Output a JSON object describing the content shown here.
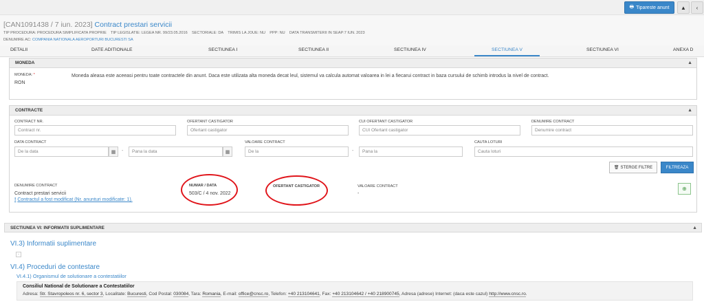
{
  "toolbar": {
    "print_label": "Tipareste anunt",
    "collapse_symbol": "▲",
    "back_symbol": "‹"
  },
  "header": {
    "code": "[CAN1091438 / 7 iun. 2023]",
    "title": "Contract prestari servicii",
    "meta_row1": [
      {
        "label": "TIP PROCEDURA:",
        "value": "PROCEDURA SIMPLIFICATA PROPRIE"
      },
      {
        "label": "TIP LEGISLATIE:",
        "value": "LEGEA NR. 99/23.05.2016"
      },
      {
        "label": "SECTORIALE:",
        "value": "DA"
      },
      {
        "label": "TRIMIS LA JOUE:",
        "value": "NU"
      },
      {
        "label": "PPP:",
        "value": "NU"
      },
      {
        "label": "DATA TRANSMITERII IN SEAP:",
        "value": "7 IUN. 2023"
      }
    ],
    "authority_label": "DENUMIRE AC:",
    "authority_value": "COMPANIA NATIONALA AEROPORTURI BUCURESTI SA"
  },
  "tabs": [
    "DETALII",
    "DATE ADITIONALE",
    "SECTIUNEA I",
    "SECTIUNEA II",
    "SECTIUNEA IV",
    "SECTIUNEA V",
    "SECTIUNEA VI",
    "ANEXA D"
  ],
  "active_tab": "SECTIUNEA V",
  "moneda": {
    "heading": "MONEDA",
    "label": "MONEDA:",
    "required_mark": "*",
    "value": "RON",
    "description": "Moneda aleasa este aceeasi pentru toate contractele din anunt. Daca este utilizata alta moneda decat leul, sistemul va calcula automat valoarea in lei a fiecarui contract in baza cursului de schimb introdus la nivel de contract."
  },
  "contracte": {
    "heading": "CONTRACTE",
    "filters": {
      "contract_nr_label": "CONTRACT NR.",
      "contract_nr_placeholder": "Contract nr.",
      "ofertant_label": "OFERTANT CASTIGATOR",
      "ofertant_placeholder": "Ofertant castigator",
      "cui_label": "CUI OFERTANT CASTIGATOR",
      "cui_placeholder": "CUI Ofertant castigator",
      "denumire_label": "DENUMIRE CONTRACT",
      "denumire_placeholder": "Denumire contract",
      "data_label": "DATA CONTRACT",
      "data_from_placeholder": "De la data",
      "data_to_placeholder": "Pana la data",
      "valoare_label": "VALOARE CONTRACT",
      "valoare_from_placeholder": "De la",
      "valoare_to_placeholder": "Pana la",
      "loturi_label": "CAUTA LOTURI",
      "loturi_placeholder": "Cauta loturi",
      "range_dash": "-"
    },
    "clear_label": "STERGE FILTRE",
    "filter_label": "FILTREAZA",
    "result": {
      "col_denumire": "DENUMIRE CONTRACT",
      "col_numar": "NUMAR / DATA",
      "col_ofertant": "OFERTANT CASTIGATOR",
      "col_valoare": "VALOARE CONTRACT",
      "denumire": "Contract prestari servicii",
      "numar": "503/C / 4 nov. 2022",
      "valoare": "-",
      "modified_mark": "!",
      "modified_link": "Contractul a fost modificat (Nr. anunturi modificate: 1)."
    }
  },
  "sectiunea6": {
    "heading": "SECTIUNEA VI: INFORMATII SUPLIMENTARE",
    "vi3": "VI.3) Informatii suplimentare",
    "small_box": "-",
    "vi4": "VI.4) Proceduri de contestare",
    "vi41": "VI.4.1) Organismul de solutionare a contestatiilor",
    "council_name": "Consiliul National de Solutionare a Contestatiilor",
    "address": {
      "adresa_label": "Adresa:",
      "adresa": "Str. Stavropoleos nr. 6, sector 3",
      "localitate_label": ", Localitate:",
      "localitate": "Bucuresti",
      "cod_label": ", Cod Postal:",
      "cod": "030084",
      "tara_label": ", Tara:",
      "tara": "Romania",
      "email_label": ", E-mail:",
      "email": "office@cnsc.ro",
      "telefon_label": ", Telefon:",
      "telefon": "+40 213104641",
      "fax_label": ", Fax:",
      "fax": "+40 213104642 / +40 218900745",
      "internet_label": ", Adresa (adrese) Internet: (daca este cazul)",
      "internet": "http://www.cnsc.ro",
      "end": "."
    }
  },
  "colors": {
    "accent": "#3a87c9",
    "annotation": "#e0141a"
  }
}
